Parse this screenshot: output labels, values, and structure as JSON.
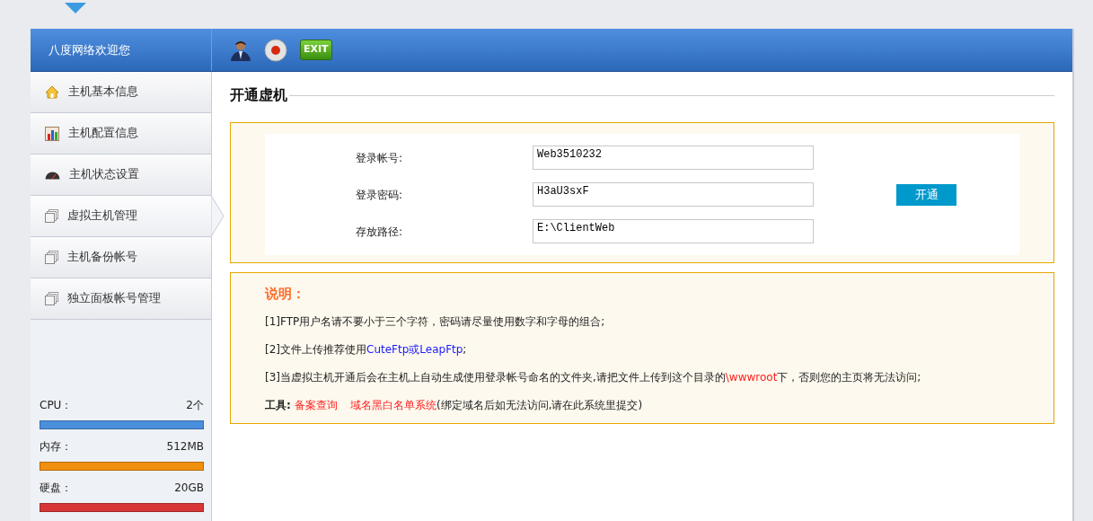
{
  "header": {
    "welcome": "八度网络欢迎您",
    "tools": [
      {
        "kind": "user"
      },
      {
        "kind": "record"
      },
      {
        "kind": "exit",
        "label": "EXIT"
      }
    ]
  },
  "sidebar": {
    "items": [
      {
        "label": "主机基本信息",
        "selected": false
      },
      {
        "label": "主机配置信息",
        "selected": false
      },
      {
        "label": "主机状态设置",
        "selected": false
      },
      {
        "label": "虚拟主机管理",
        "selected": true
      },
      {
        "label": "主机备份帐号",
        "selected": false
      },
      {
        "label": "独立面板帐号管理",
        "selected": false
      }
    ],
    "stats": [
      {
        "label": "CPU：",
        "value": "2个",
        "color": "#4a8fdc"
      },
      {
        "label": "内存：",
        "value": "512MB",
        "color": "#f0900f"
      },
      {
        "label": "硬盘：",
        "value": "20GB",
        "color": "#d83636"
      }
    ]
  },
  "page_title": "开通虚机",
  "form": {
    "fields": [
      {
        "label": "登录帐号:",
        "value": "Web3510232"
      },
      {
        "label": "登录密码:",
        "value": "H3aU3sxF"
      },
      {
        "label": "存放路径:",
        "value": "E:\\ClientWeb"
      }
    ],
    "submit": "开通"
  },
  "notes": {
    "title": "说明：",
    "lines": [
      [
        {
          "kind": "plain",
          "text": "[1]FTP用户名请不要小于三个字符，密码请尽量使用数字和字母的组合;"
        }
      ],
      [
        {
          "kind": "plain",
          "text": "[2]文件上传推荐使用"
        },
        {
          "kind": "link",
          "text": "CuteFtp或LeapFtp"
        },
        {
          "kind": "plain",
          "text": ";"
        }
      ],
      [
        {
          "kind": "plain",
          "text": "[3]当虚拟主机开通后会在主机上自动生成使用登录帐号命名的文件夹,请把文件上传到这个目录的"
        },
        {
          "kind": "highlight",
          "text": "\\wwwroot"
        },
        {
          "kind": "plain",
          "text": "下，否则您的主页将无法访问;"
        }
      ],
      [
        {
          "kind": "bold",
          "text": "工具: "
        },
        {
          "kind": "redlink",
          "text": "备案查询"
        },
        {
          "kind": "redlink",
          "text": "域名黑白名单系统"
        },
        {
          "kind": "plain",
          "text": "(绑定域名后如无法访问,请在此系统里提交)"
        }
      ]
    ]
  }
}
